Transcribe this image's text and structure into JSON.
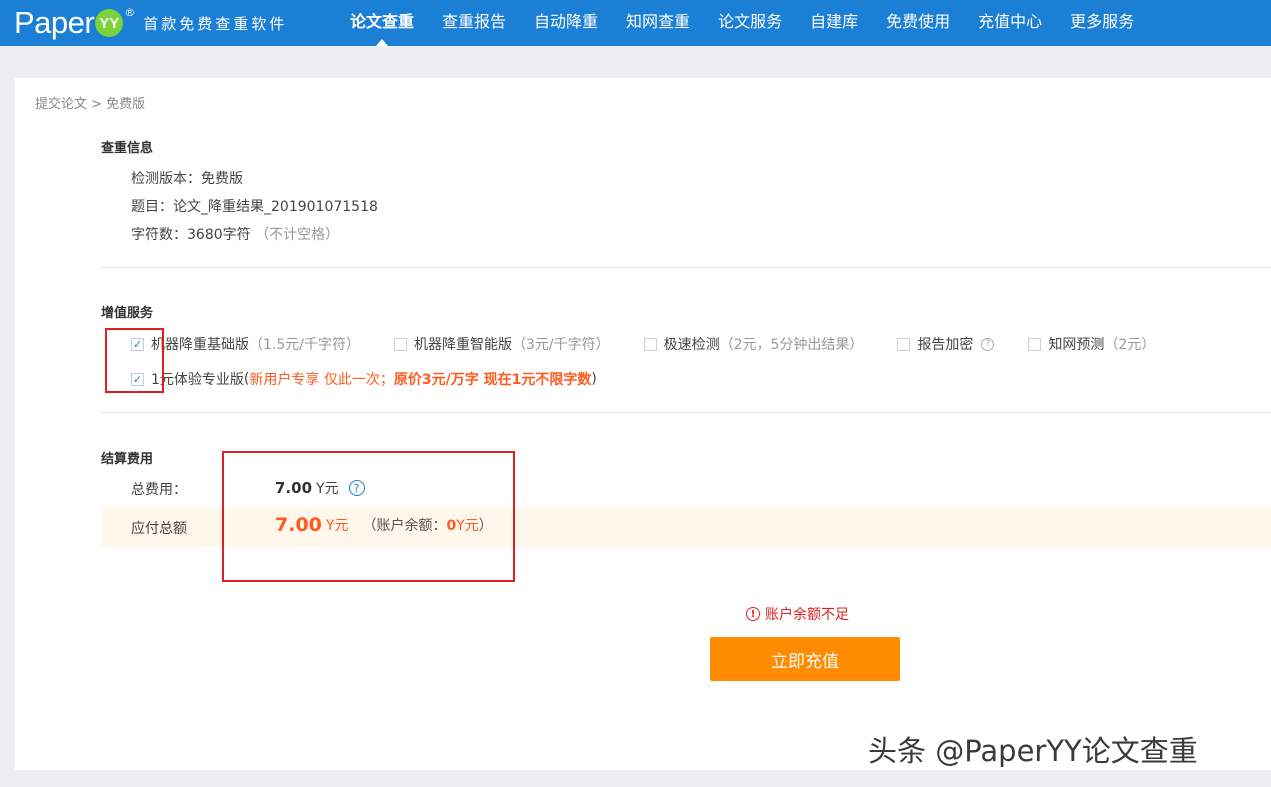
{
  "brand": {
    "logo_text": "Paper",
    "logo_badge": "YY",
    "logo_reg": "®",
    "slogan": "首款免费查重软件"
  },
  "nav": {
    "items": [
      {
        "label": "论文查重",
        "active": true
      },
      {
        "label": "查重报告"
      },
      {
        "label": "自动降重"
      },
      {
        "label": "知网查重"
      },
      {
        "label": "论文服务"
      },
      {
        "label": "自建库"
      },
      {
        "label": "免费使用"
      },
      {
        "label": "充值中心"
      },
      {
        "label": "更多服务"
      }
    ]
  },
  "breadcrumb": "提交论文 > 免费版",
  "check_info": {
    "title": "查重信息",
    "version": "检测版本：免费版",
    "subject": "题目：论文_降重结果_201901071518",
    "chars": "字符数：3680字符",
    "chars_note": "（不计空格）"
  },
  "services": {
    "title": "增值服务",
    "options": [
      {
        "label": "机器降重基础版",
        "price": "（1.5元/千字符）",
        "checked": true
      },
      {
        "label": "机器降重智能版",
        "price": "（3元/千字符）",
        "checked": false
      },
      {
        "label": "极速检测",
        "price": "（2元，5分钟出结果）",
        "checked": false
      },
      {
        "label": "报告加密",
        "price": "",
        "checked": false
      },
      {
        "label": "知网预测",
        "price": "（2元）",
        "checked": false
      }
    ],
    "trial": {
      "label": "1元体验专业版",
      "open": "(",
      "promo": "新用户专享 仅此一次；",
      "promo_bold": "原价3元/万字 现在1元不限字数",
      "close": ")",
      "checked": true
    },
    "check_mark": "✓",
    "help_mark": "?"
  },
  "settlement": {
    "title": "结算费用",
    "total_label": "总费用：",
    "total_value": "7.00",
    "total_unit": "Y元",
    "help_mark": "?",
    "payable_label": "应付总额",
    "payable_value": "7.00",
    "payable_unit": "Y元",
    "balance_open": "（账户余额：",
    "balance_value": "0",
    "balance_unit": "Y元",
    "balance_close": "）"
  },
  "warning": {
    "icon": "!",
    "text": "账户余额不足"
  },
  "recharge_button": "立即充值",
  "watermark": "头条 @PaperYY论文查重",
  "colors": {
    "topbar": "#1c7fd6",
    "accent_orange": "#ff5a1f",
    "button_orange": "#ff8c00",
    "annotation_red": "#e02020"
  }
}
